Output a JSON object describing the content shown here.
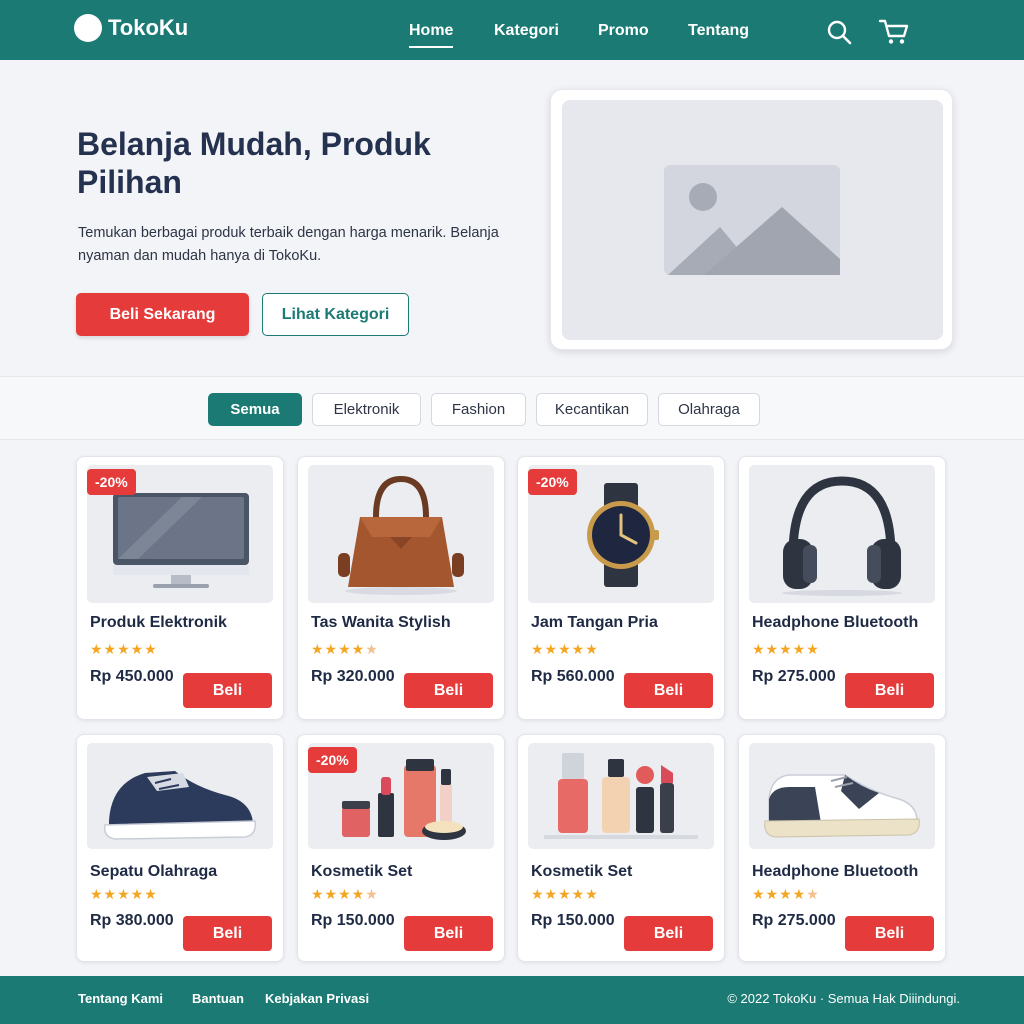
{
  "brand": {
    "name": "TokoKu"
  },
  "nav": {
    "home": "Home",
    "kategori": "Kategori",
    "promo": "Promo",
    "tentang": "Tentang"
  },
  "hero": {
    "title": "Belanja Mudah, Produk Pilihan",
    "description": "Temukan berbagai produk terbaik dengan harga menarik. Belanja nyaman dan mudah hanya di TokoKu.",
    "primary_button": "Beli Sekarang",
    "secondary_button": "Lihat Kategori"
  },
  "filters": [
    "Semua",
    "Elektronik",
    "Fashion",
    "Kecantikan",
    "Olahraga"
  ],
  "products": [
    {
      "name": "Produk Elektronik",
      "price": "Rp 450.000",
      "badge": "-20%",
      "rating": 5,
      "buy": "Beli",
      "image": "monitor"
    },
    {
      "name": "Tas Wanita Stylish",
      "price": "Rp 320.000",
      "badge": "",
      "rating": 4.5,
      "buy": "Beli",
      "image": "handbag"
    },
    {
      "name": "Jam Tangan Pria",
      "price": "Rp 560.000",
      "badge": "-20%",
      "rating": 5,
      "buy": "Beli",
      "image": "watch"
    },
    {
      "name": "Headphone Bluetooth",
      "price": "Rp 275.000",
      "badge": "",
      "rating": 5,
      "buy": "Beli",
      "image": "headphones"
    },
    {
      "name": "Sepatu Olahraga",
      "price": "Rp 380.000",
      "badge": "",
      "rating": 5,
      "buy": "Beli",
      "image": "sneaker-dark"
    },
    {
      "name": "Kosmetik Set",
      "price": "Rp 150.000",
      "badge": "-20%",
      "rating": 4.5,
      "buy": "Beli",
      "image": "cosmetics"
    },
    {
      "name": "Kosmetik Set",
      "price": "Rp 150.000",
      "badge": "",
      "rating": 5,
      "buy": "Beli",
      "image": "cosmetics-bottles"
    },
    {
      "name": "Headphone Bluetooth",
      "price": "Rp 275.000",
      "badge": "",
      "rating": 4.5,
      "buy": "Beli",
      "image": "sneaker-light"
    }
  ],
  "footer": {
    "links": [
      "Tentang Kami",
      "Bantuan",
      "Kebjakan Privasi"
    ],
    "copyright": "© 2022 TokoKu · Semua Hak Diiindungi."
  },
  "colors": {
    "primary": "#1b7a73",
    "accent": "#e53b3b",
    "star": "#f4a623"
  }
}
